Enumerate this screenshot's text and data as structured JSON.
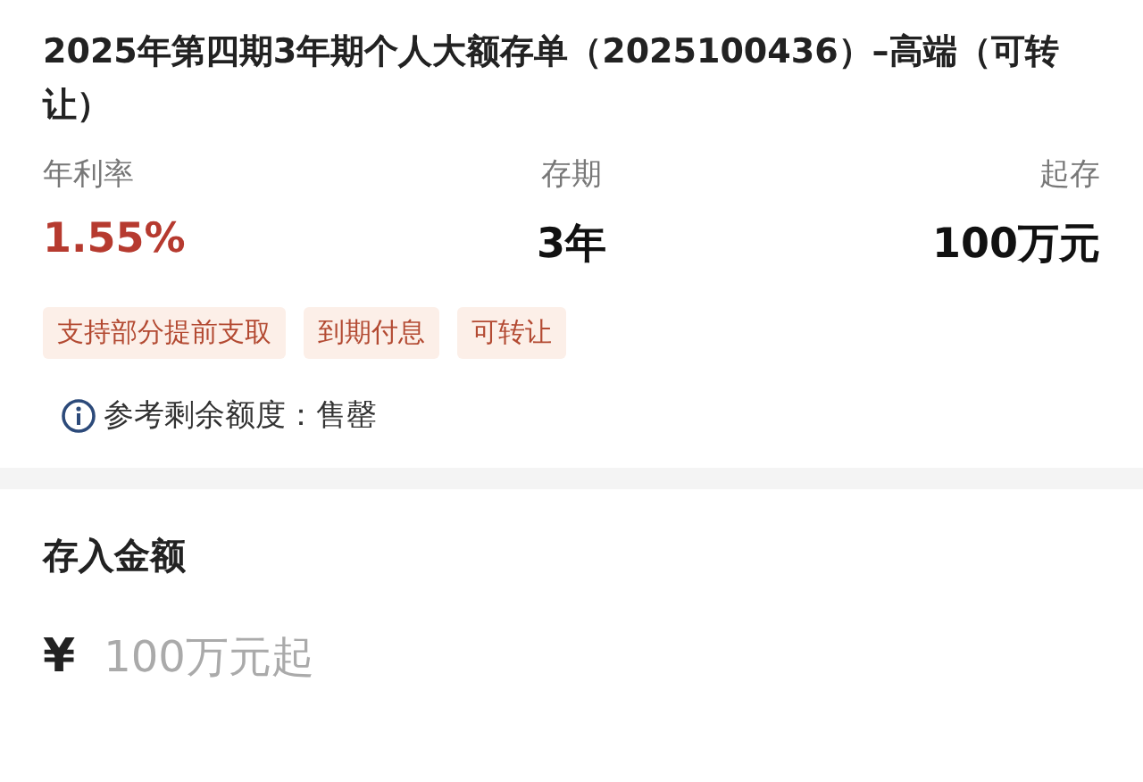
{
  "product": {
    "title": "2025年第四期3年期个人大额存单（2025100436）–高端（可转让）",
    "stats": [
      {
        "label": "年利率",
        "value": "1.55%",
        "highlight": true
      },
      {
        "label": "存期",
        "value": "3年",
        "highlight": false
      },
      {
        "label": "起存",
        "value": "100万元",
        "highlight": false
      }
    ],
    "tags": [
      "支持部分提前支取",
      "到期付息",
      "可转让"
    ],
    "info": "参考剩余额度：售罄"
  },
  "deposit": {
    "heading": "存入金额",
    "currency": "¥",
    "placeholder": "100万元起"
  }
}
